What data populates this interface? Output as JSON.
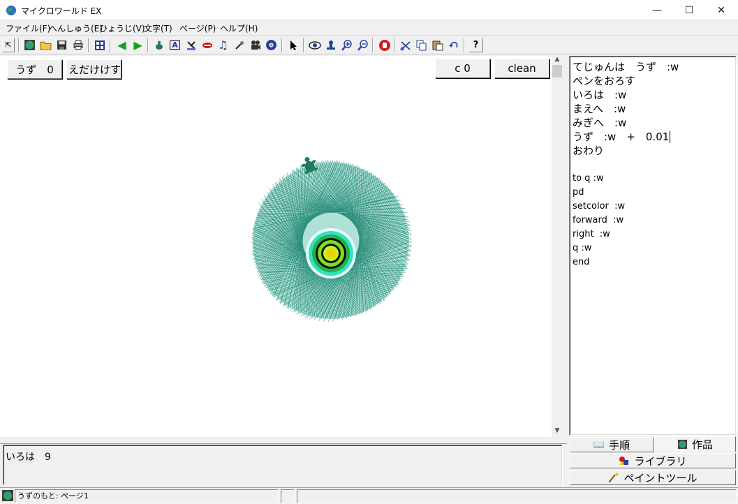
{
  "window": {
    "title": "マイクロワールド EX",
    "minimize": "—",
    "maximize": "☐",
    "close": "✕"
  },
  "menu": [
    "ファイル(F)",
    "へんしゅう(E)",
    "ひょうじ(V)",
    "文字(T)",
    "ページ(P)",
    "ヘルプ(H)"
  ],
  "toolbar": {
    "text_tool_glyph": "A",
    "help_glyph": "?"
  },
  "canvas": {
    "uzu_button": "うず　0",
    "edakesu_button": "えだけけす",
    "c_button": "c 0",
    "clean_button": "clean"
  },
  "procedures": {
    "lines": [
      "てじゅんは　うず　:w",
      "ペンをおろす",
      "いろは　:w",
      "まえへ　:w",
      "みぎへ　:w",
      "うず　:w　+　0.01",
      "おわり",
      "",
      "to q :w",
      "pd",
      "setcolor  :w",
      "forward  :w",
      "right  :w",
      "q :w",
      "end"
    ]
  },
  "command_center": {
    "text": "いろは　9"
  },
  "tabs": {
    "procedures": "手順",
    "project": "作品",
    "library": "ライブラリ",
    "paint": "ペイントツール"
  },
  "status": {
    "text": "うずのもと: ページ1"
  },
  "colors": {
    "spiral": "#1aa88a",
    "spiral_dark": "#0e7a66",
    "turtle": "#1f7a5e",
    "center_green": "#22b14c",
    "center_yellow": "#e8d400"
  }
}
